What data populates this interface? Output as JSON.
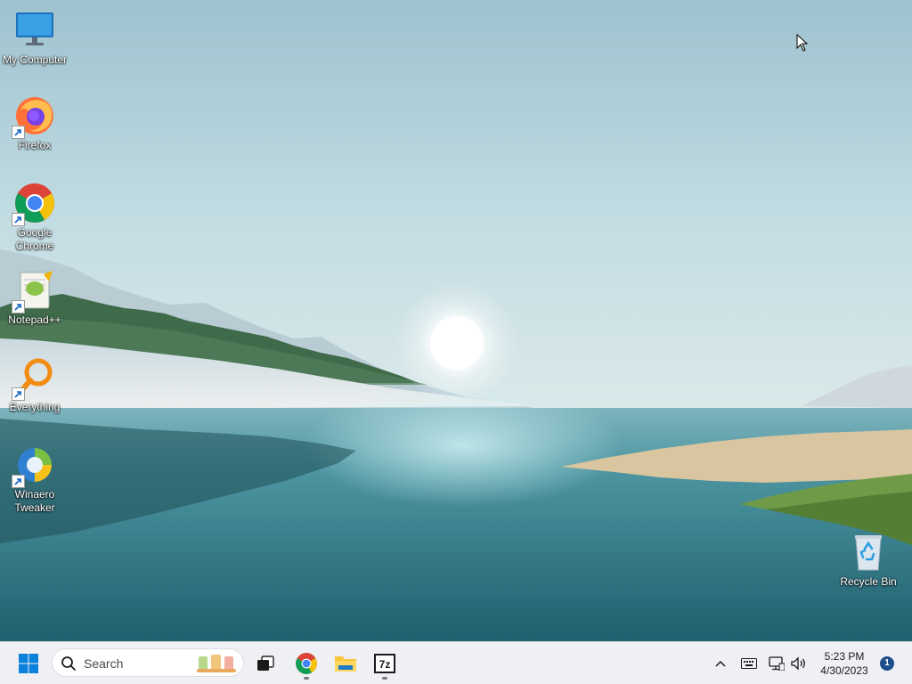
{
  "desktop": {
    "icons": [
      {
        "label": "My Computer",
        "icon": "monitor-icon",
        "shortcut": false
      },
      {
        "label": "Firefox",
        "icon": "firefox-icon",
        "shortcut": true
      },
      {
        "label": "Google Chrome",
        "icon": "chrome-icon",
        "shortcut": true
      },
      {
        "label": "Notepad++",
        "icon": "notepadpp-icon",
        "shortcut": true
      },
      {
        "label": "Everything",
        "icon": "magnifier-icon",
        "shortcut": true
      },
      {
        "label": "Winaero Tweaker",
        "icon": "winaero-tweaker-icon",
        "shortcut": true
      },
      {
        "label": "Recycle Bin",
        "icon": "recycle-bin-icon",
        "shortcut": false
      }
    ]
  },
  "taskbar": {
    "start_icon": "windows-logo-icon",
    "search": {
      "placeholder": "Search",
      "icon": "search-icon"
    },
    "apps": [
      {
        "name": "Task View",
        "icon": "task-view-icon",
        "running": false
      },
      {
        "name": "Google Chrome",
        "icon": "chrome-icon",
        "running": true
      },
      {
        "name": "File Explorer",
        "icon": "folder-icon",
        "running": false
      },
      {
        "name": "7-Zip",
        "icon": "seven-zip-icon",
        "running": true
      }
    ],
    "tray": {
      "icons": [
        "chevron-up-icon",
        "keyboard-icon",
        "network-icon",
        "volume-icon"
      ],
      "time": "5:23 PM",
      "date": "4/30/2023",
      "notification_count": "1"
    }
  },
  "colors": {
    "taskbar_bg": "#eef0f4",
    "sky": "#a9ccd8",
    "water": "#2f7b8a",
    "accent": "#0078d4"
  }
}
